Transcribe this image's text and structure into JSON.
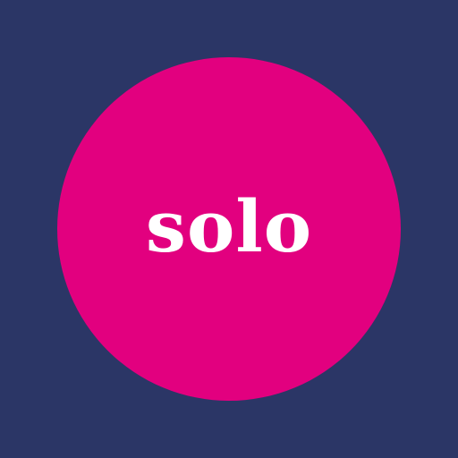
{
  "logo": {
    "wordmark": "solo"
  },
  "colors": {
    "background": "#2b3666",
    "circle": "#e2007f",
    "text": "#ffffff"
  }
}
